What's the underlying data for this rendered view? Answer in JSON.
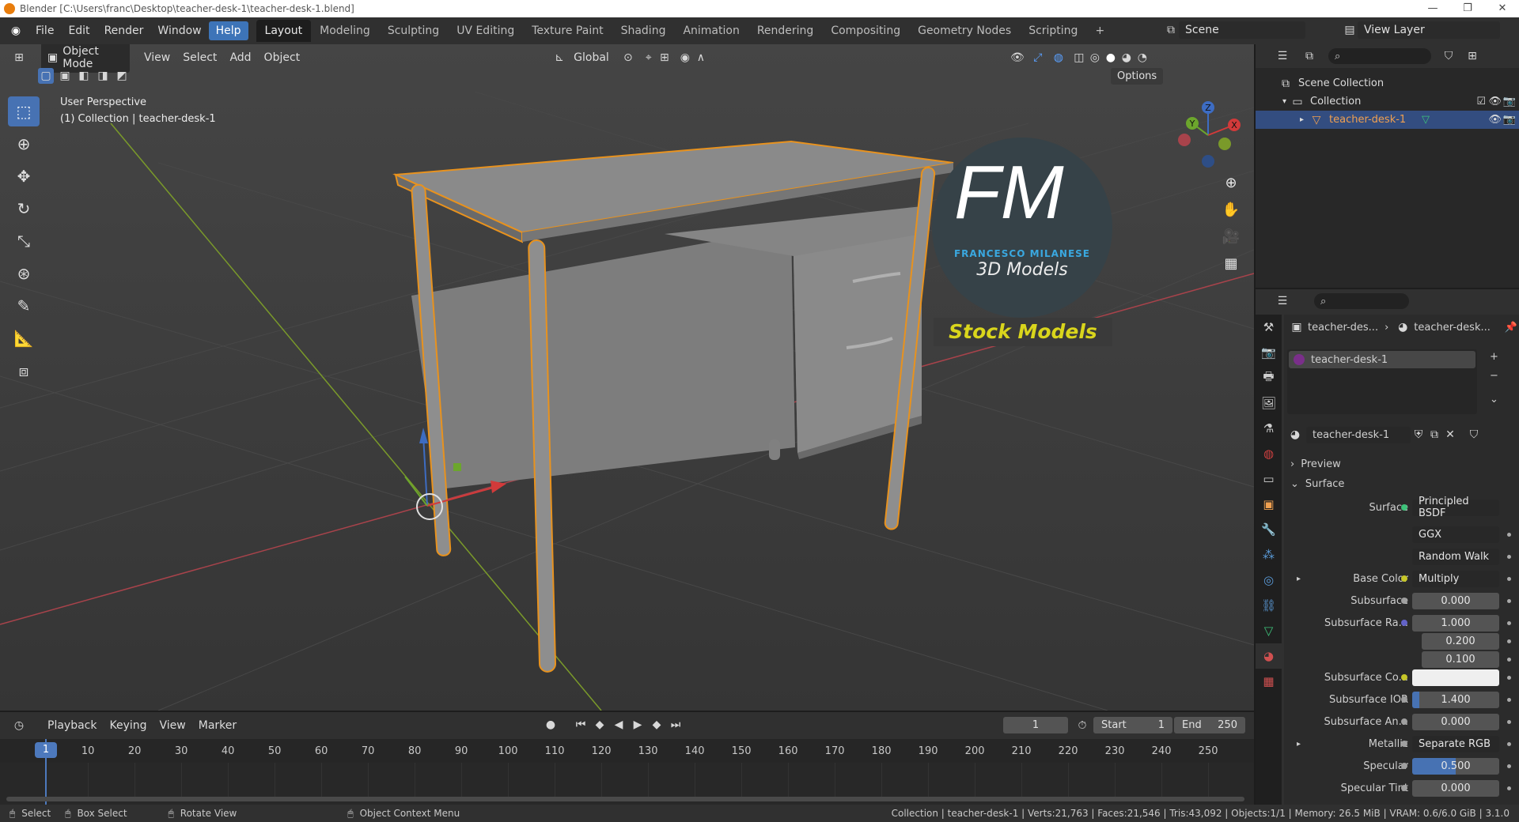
{
  "window": {
    "title": "Blender [C:\\Users\\franc\\Desktop\\teacher-desk-1\\teacher-desk-1.blend]",
    "minimize": "—",
    "maximize": "❐",
    "close": "✕"
  },
  "menu": {
    "items": [
      "File",
      "Edit",
      "Render",
      "Window",
      "Help"
    ],
    "active": "Help"
  },
  "workspaces": {
    "tabs": [
      "Layout",
      "Modeling",
      "Sculpting",
      "UV Editing",
      "Texture Paint",
      "Shading",
      "Animation",
      "Rendering",
      "Compositing",
      "Geometry Nodes",
      "Scripting"
    ],
    "active": "Layout",
    "add": "+"
  },
  "scene": {
    "label": "Scene",
    "view_layer": "View Layer"
  },
  "viewport": {
    "mode": "Object Mode",
    "menus": [
      "View",
      "Select",
      "Add",
      "Object"
    ],
    "transform": "Global",
    "options": "Options",
    "perspective": "User Perspective",
    "collection_info": "(1) Collection | teacher-desk-1",
    "logo_letters": "FM",
    "logo_name": "FRANCESCO MILANESE",
    "logo_sub": "3D Models",
    "logo_banner": "Stock Models",
    "axis_labels": {
      "x": "X",
      "y": "Y",
      "z": "Z"
    }
  },
  "outliner": {
    "scene_collection": "Scene Collection",
    "collection": "Collection",
    "object": "teacher-desk-1"
  },
  "properties": {
    "breadcrumb": [
      "teacher-des...",
      "teacher-desk..."
    ],
    "material_slot": "teacher-desk-1",
    "material_name": "teacher-desk-1",
    "panels": {
      "preview": "Preview",
      "surface": "Surface"
    },
    "surface_label": "Surface",
    "surface_value": "Principled BSDF",
    "distribution": "GGX",
    "subsurface_method": "Random Walk",
    "rows": [
      {
        "label": "Base Color",
        "value": "Multiply",
        "socket": "#c7c729",
        "dark": true,
        "expand": "▸"
      },
      {
        "label": "Subsurface",
        "value": "0.000",
        "socket": "#a0a0a0"
      },
      {
        "label": "Subsurface Ra...",
        "value": "1.000",
        "socket": "#6363c7"
      },
      {
        "label": "",
        "value": "0.200"
      },
      {
        "label": "",
        "value": "0.100"
      },
      {
        "label": "Subsurface Co...",
        "value": "",
        "socket": "#c7c729",
        "white": true
      },
      {
        "label": "Subsurface IOR",
        "value": "1.400",
        "socket": "#a0a0a0",
        "blue": true
      },
      {
        "label": "Subsurface An...",
        "value": "0.000",
        "socket": "#a0a0a0"
      },
      {
        "label": "Metallic",
        "value": "Separate RGB",
        "socket": "#a0a0a0",
        "dark": true,
        "expand": "▸"
      },
      {
        "label": "Specular",
        "value": "0.500",
        "socket": "#a0a0a0",
        "blue": true
      },
      {
        "label": "Specular Tint",
        "value": "0.000",
        "socket": "#a0a0a0"
      }
    ]
  },
  "timeline": {
    "menus": [
      "Playback",
      "Keying",
      "View",
      "Marker"
    ],
    "current_frame": "1",
    "start_label": "Start",
    "start": "1",
    "end_label": "End",
    "end": "250",
    "ticks": [
      "1",
      "10",
      "20",
      "30",
      "40",
      "50",
      "60",
      "70",
      "80",
      "90",
      "100",
      "110",
      "120",
      "130",
      "140",
      "150",
      "160",
      "170",
      "180",
      "190",
      "200",
      "210",
      "220",
      "230",
      "240",
      "250"
    ]
  },
  "statusbar": {
    "select": "Select",
    "box_select": "Box Select",
    "rotate": "Rotate View",
    "context": "Object Context Menu",
    "stats": "Collection | teacher-desk-1 | Verts:21,763 | Faces:21,546 | Tris:43,092 | Objects:1/1 | Memory: 26.5 MiB | VRAM: 0.6/6.0 GiB | 3.1.0"
  }
}
